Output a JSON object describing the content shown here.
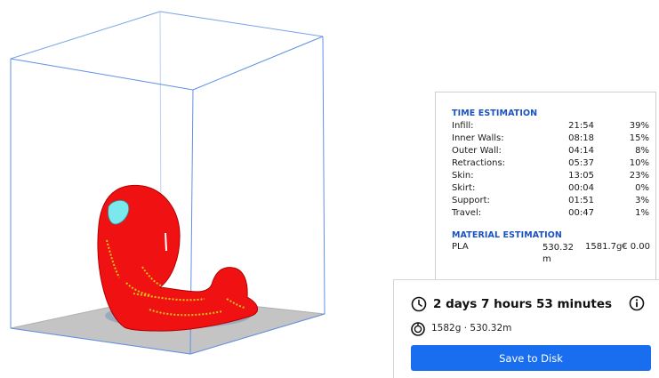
{
  "time_estimation": {
    "title": "TIME ESTIMATION",
    "rows": [
      {
        "label": "Infill:",
        "time": "21:54",
        "percent": "39%"
      },
      {
        "label": "Inner Walls:",
        "time": "08:18",
        "percent": "15%"
      },
      {
        "label": "Outer Wall:",
        "time": "04:14",
        "percent": "8%"
      },
      {
        "label": "Retractions:",
        "time": "05:37",
        "percent": "10%"
      },
      {
        "label": "Skin:",
        "time": "13:05",
        "percent": "23%"
      },
      {
        "label": "Skirt:",
        "time": "00:04",
        "percent": "0%"
      },
      {
        "label": "Support:",
        "time": "01:51",
        "percent": "3%"
      },
      {
        "label": "Travel:",
        "time": "00:47",
        "percent": "1%"
      }
    ]
  },
  "material_estimation": {
    "title": "MATERIAL ESTIMATION",
    "rows": [
      {
        "name": "PLA",
        "length": "530.32 m",
        "weight": "1581.7g",
        "cost": "€ 0.00"
      }
    ]
  },
  "print_summary": {
    "total_time": "2 days 7 hours 53 minutes",
    "material_summary": "1582g · 530.32m",
    "save_label": "Save to Disk",
    "icons": {
      "clock": "clock-icon",
      "info": "info-icon",
      "spool": "spool-icon"
    }
  },
  "colors": {
    "accent": "#196ef0",
    "section_title": "#1a52c4",
    "model": "#ef1010",
    "model_highlight": "#d8e21c",
    "build_plate": "#c7c7c7",
    "build_volume_lines": "#6d9be8"
  }
}
